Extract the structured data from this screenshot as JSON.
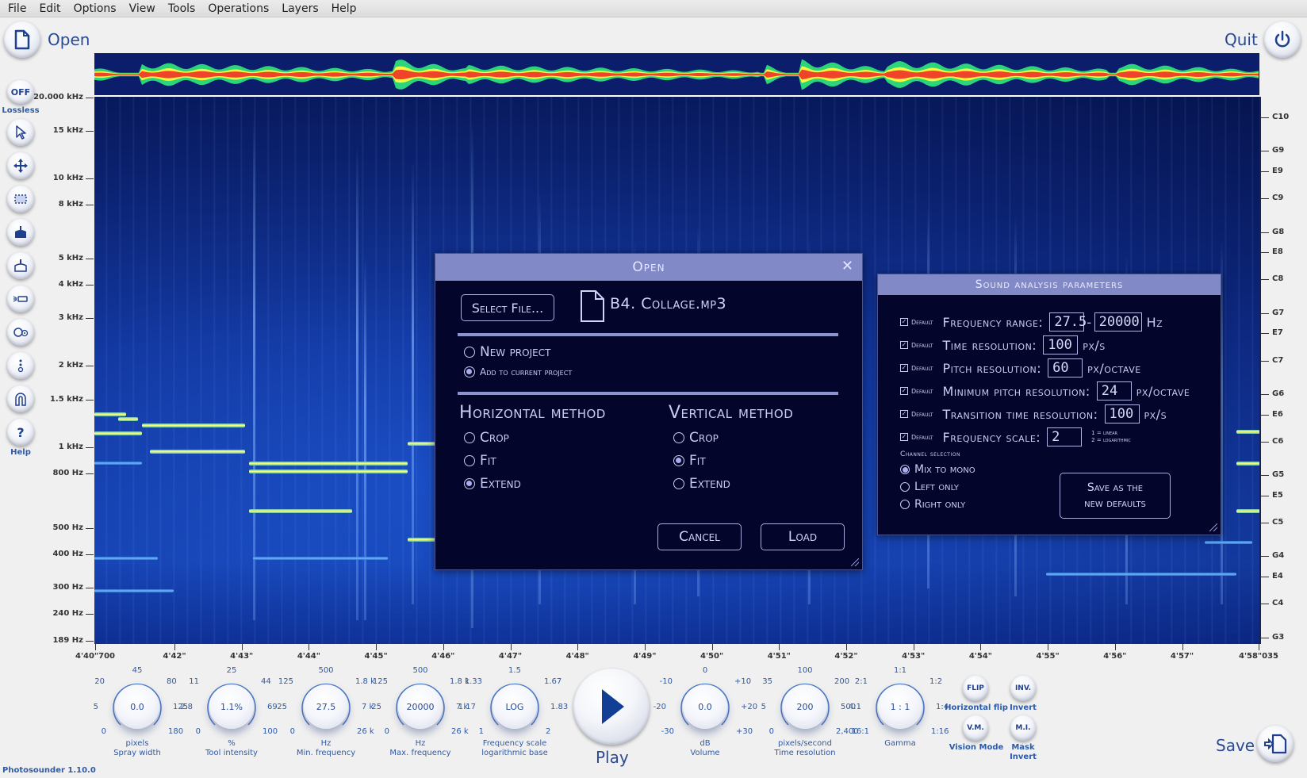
{
  "menu": [
    "File",
    "Edit",
    "Options",
    "View",
    "Tools",
    "Operations",
    "Layers",
    "Help"
  ],
  "top": {
    "open_label": "Open",
    "quit_label": "Quit"
  },
  "toolbar": {
    "lossless_button": "OFF",
    "lossless_caption": "Lossless",
    "help_caption": "Help",
    "tools": [
      "pointer-tool",
      "move-tool",
      "selection-tool",
      "bucket-tool",
      "stamp-tool",
      "flashlight-tool",
      "tool-settings-tool",
      "more-tool",
      "magnet-tool",
      "help-tool"
    ]
  },
  "frequency_axis": [
    "20.000 kHz",
    "15 kHz",
    "10 kHz",
    "8 kHz",
    "5 kHz",
    "4 kHz",
    "3 kHz",
    "2 kHz",
    "1.5 kHz",
    "1 kHz",
    "800 Hz",
    "500 Hz",
    "400 Hz",
    "300 Hz",
    "240 Hz",
    "189 Hz"
  ],
  "note_axis": [
    "C10",
    "G9",
    "E9",
    "C9",
    "G8",
    "E8",
    "C8",
    "G7",
    "E7",
    "C7",
    "G6",
    "E6",
    "C6",
    "G5",
    "E5",
    "C5",
    "G4",
    "E4",
    "C4",
    "G3"
  ],
  "time_axis": [
    "4'40\"700",
    "4'42\"",
    "4'43\"",
    "4'44\"",
    "4'45\"",
    "4'46\"",
    "4'47\"",
    "4'48\"",
    "4'49\"",
    "4'50\"",
    "4'51\"",
    "4'52\"",
    "4'53\"",
    "4'54\"",
    "4'55\"",
    "4'56\"",
    "4'57\"",
    "4'58\"035"
  ],
  "open_dialog": {
    "title": "Open",
    "select_file_label": "Select File...",
    "file_name": "B4. Collage.mp3",
    "project_options": [
      {
        "label": "New project",
        "selected": false
      },
      {
        "label": "Add to current project",
        "selected": true
      }
    ],
    "horizontal_title": "Horizontal method",
    "horizontal_options": [
      {
        "label": "Crop",
        "selected": false
      },
      {
        "label": "Fit",
        "selected": false
      },
      {
        "label": "Extend",
        "selected": true
      }
    ],
    "vertical_title": "Vertical method",
    "vertical_options": [
      {
        "label": "Crop",
        "selected": false
      },
      {
        "label": "Fit",
        "selected": true
      },
      {
        "label": "Extend",
        "selected": false
      }
    ],
    "cancel_label": "Cancel",
    "load_label": "Load"
  },
  "analysis_dialog": {
    "title": "Sound analysis parameters",
    "default_label": "Default",
    "rows": [
      {
        "label": "Frequency range:",
        "value": "27.5",
        "value2": "20000",
        "sep": "-",
        "unit": "Hz",
        "default_checked": true
      },
      {
        "label": "Time resolution:",
        "value": "100",
        "unit": "px/s",
        "default_checked": true
      },
      {
        "label": "Pitch resolution:",
        "value": "60",
        "unit": "px/octave",
        "default_checked": true
      },
      {
        "label": "Minimum pitch resolution:",
        "value": "24",
        "unit": "px/octave",
        "default_checked": true
      },
      {
        "label": "Transition time resolution:",
        "value": "100",
        "unit": "px/s",
        "default_checked": true
      },
      {
        "label": "Frequency scale:",
        "value": "2",
        "unit_line1": "1 = linear",
        "unit_line2": "2 = logarithmic",
        "default_checked": true
      }
    ],
    "channel_title": "Channel selection",
    "channel_options": [
      {
        "label": "Mix to mono",
        "selected": true
      },
      {
        "label": "Left only",
        "selected": false
      },
      {
        "label": "Right only",
        "selected": false
      }
    ],
    "save_defaults_label_1": "Save as the",
    "save_defaults_label_2": "new defaults"
  },
  "knobs": [
    {
      "name": "spray-width",
      "value": "0.0",
      "unit": "pixels",
      "caption": "Spray width",
      "ticks": [
        "0",
        "5",
        "20",
        "45",
        "80",
        "125",
        "180"
      ]
    },
    {
      "name": "tool-intensity",
      "value": "1.1%",
      "unit": "%",
      "caption": "Tool intensity",
      "ticks": [
        "0",
        "2.8",
        "11",
        "25",
        "44",
        "69",
        "100"
      ]
    },
    {
      "name": "min-frequency",
      "value": "27.5",
      "unit": "Hz",
      "caption": "Min. frequency",
      "ticks": [
        "0",
        "25",
        "125",
        "500",
        "1.8 k",
        "7 k",
        "26 k"
      ]
    },
    {
      "name": "max-frequency",
      "value": "20000",
      "unit": "Hz",
      "caption": "Max. frequency",
      "ticks": [
        "0",
        "25",
        "125",
        "500",
        "1.8 k",
        "7 k",
        "26 k"
      ]
    },
    {
      "name": "frequency-scale",
      "value": "LOG",
      "unit": "Frequency scale",
      "caption": "logarithmic base",
      "ticks": [
        "1",
        "1.17",
        "1.33",
        "1.5",
        "1.67",
        "1.83",
        "2"
      ]
    },
    {
      "name": "volume",
      "value": "0.0",
      "unit": "dB",
      "caption": "Volume",
      "ticks": [
        "-30",
        "-20",
        "-10",
        "0",
        "+10",
        "+20",
        "+30"
      ]
    },
    {
      "name": "time-resolution",
      "value": "200",
      "unit": "pixels/second",
      "caption": "Time resolution",
      "ticks": [
        "0",
        "5",
        "35",
        "100",
        "200",
        "500",
        "2,400"
      ]
    },
    {
      "name": "gamma",
      "value": "1 : 1",
      "unit": "",
      "caption": "Gamma",
      "ticks": [
        "16:1",
        "4:1",
        "2:1",
        "1:1",
        "1:2",
        "1:4",
        "1:16"
      ]
    }
  ],
  "play_label": "Play",
  "small_buttons": [
    {
      "name": "flip",
      "label": "FLIP",
      "caption": "Horizontal flip"
    },
    {
      "name": "invert",
      "label": "INV.",
      "caption": "Invert"
    },
    {
      "name": "vision-mode",
      "label": "V.M.",
      "caption": "Vision Mode"
    },
    {
      "name": "mask-invert",
      "label": "M.I.",
      "caption": "Mask Invert"
    }
  ],
  "save_label": "Save",
  "version": "Photosounder 1.10.0"
}
